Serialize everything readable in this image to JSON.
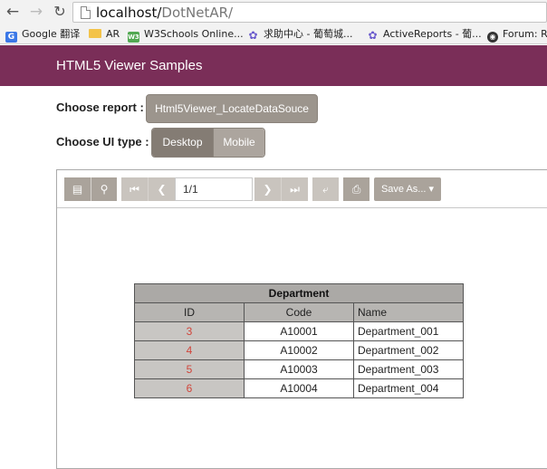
{
  "browser": {
    "url_host": "localhost/",
    "url_path": "DotNetAR/",
    "bookmarks": [
      {
        "label": "Google 翻译",
        "icon": "google-icon"
      },
      {
        "label": "AR",
        "icon": "folder-icon"
      },
      {
        "label": "W3Schools Online...",
        "icon": "w3schools-icon"
      },
      {
        "label": "求助中心 - 葡萄城...",
        "icon": "grapecity-icon"
      },
      {
        "label": "ActiveReports - 葡...",
        "icon": "grapecity-icon"
      },
      {
        "label": "Forum: R",
        "icon": "forum-icon"
      }
    ]
  },
  "header": {
    "title": "HTML5 Viewer Samples"
  },
  "choose_report": {
    "label": "Choose report :",
    "value": "Html5Viewer_LocateDataSouce"
  },
  "choose_ui": {
    "label": "Choose UI type :",
    "options": [
      "Desktop",
      "Mobile"
    ],
    "selected": "Desktop"
  },
  "toolbar": {
    "page_value": "1/1",
    "save_label": "Save As..."
  },
  "report": {
    "title": "Department",
    "columns": [
      "ID",
      "Code",
      "Name"
    ],
    "rows": [
      {
        "id": "3",
        "code": "A10001",
        "name": "Department_001"
      },
      {
        "id": "4",
        "code": "A10002",
        "name": "Department_002"
      },
      {
        "id": "5",
        "code": "A10003",
        "name": "Department_003"
      },
      {
        "id": "6",
        "code": "A10004",
        "name": "Department_004"
      }
    ]
  },
  "colors": {
    "header_bg": "#7a2e58",
    "button_bg": "#9c958d",
    "id_text": "#d0453b"
  }
}
